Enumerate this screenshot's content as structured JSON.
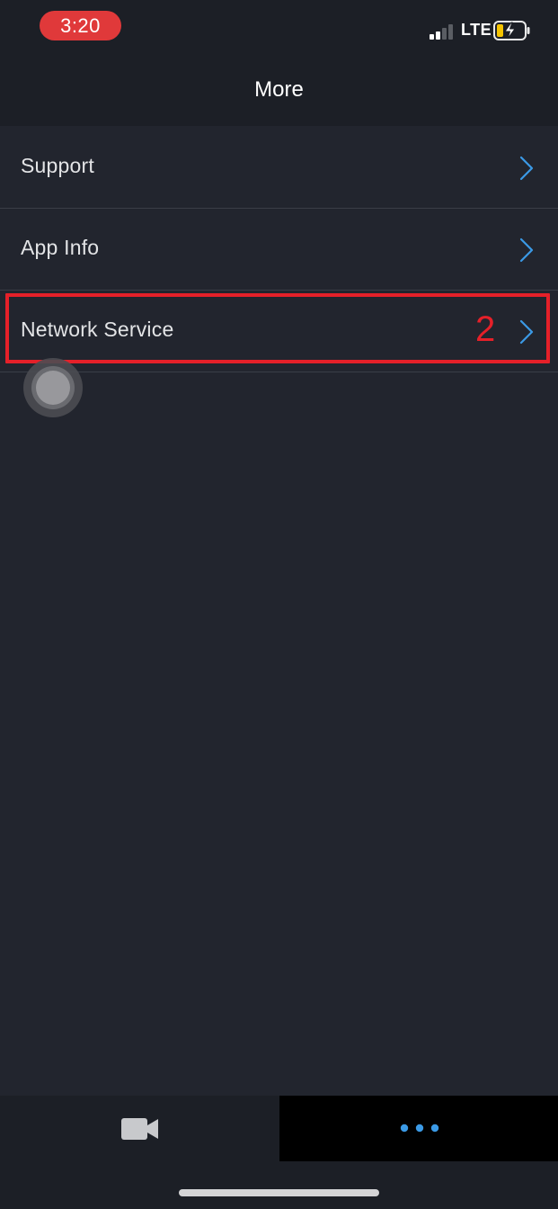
{
  "status_bar": {
    "time": "3:20",
    "network": "LTE",
    "signal_bars_filled": 2,
    "signal_bars_total": 4,
    "battery_state": "charging",
    "time_pill_color": "#e0393a"
  },
  "header": {
    "title": "More"
  },
  "menu": {
    "items": [
      {
        "label": "Support",
        "icon": "chevron-right-icon"
      },
      {
        "label": "App Info",
        "icon": "chevron-right-icon"
      },
      {
        "label": "Network Service",
        "icon": "chevron-right-icon"
      }
    ]
  },
  "annotation": {
    "number": "2",
    "color": "#e52029"
  },
  "tabbar": {
    "tabs": [
      {
        "icon": "camera-icon",
        "selected": false
      },
      {
        "icon": "more-dots-icon",
        "selected": true
      }
    ],
    "accent": "#3b9ae6"
  },
  "colors": {
    "background": "#22252e",
    "header": "#1c1f26",
    "chevron": "#3b9ae6"
  }
}
